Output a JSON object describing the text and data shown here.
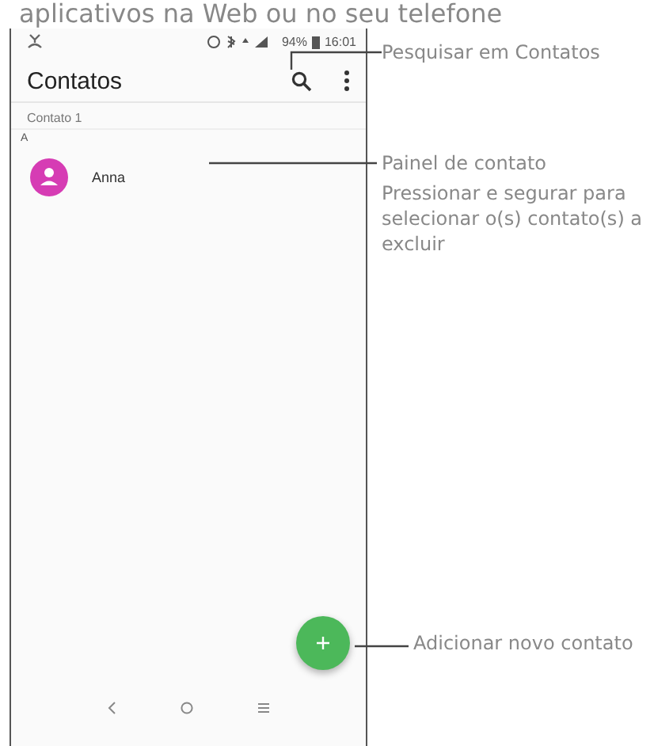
{
  "header_text": "aplicativos na Web ou no seu telefone",
  "status_bar": {
    "battery": "94%",
    "time": "16:01"
  },
  "app_bar": {
    "title": "Contatos"
  },
  "account_label": "Contato 1",
  "sections": [
    {
      "letter": "A",
      "contacts": [
        {
          "name": "Anna",
          "color": "#d63cb4"
        }
      ]
    }
  ],
  "callouts": [
    {
      "kind": "search",
      "text": "Pesquisar em Contatos"
    },
    {
      "kind": "row",
      "text": "Painel de contato",
      "note": "Pressionar e segurar para selecionar o(s) contato(s) a excluir"
    },
    {
      "kind": "fab",
      "text": "Adicionar novo contato"
    }
  ]
}
